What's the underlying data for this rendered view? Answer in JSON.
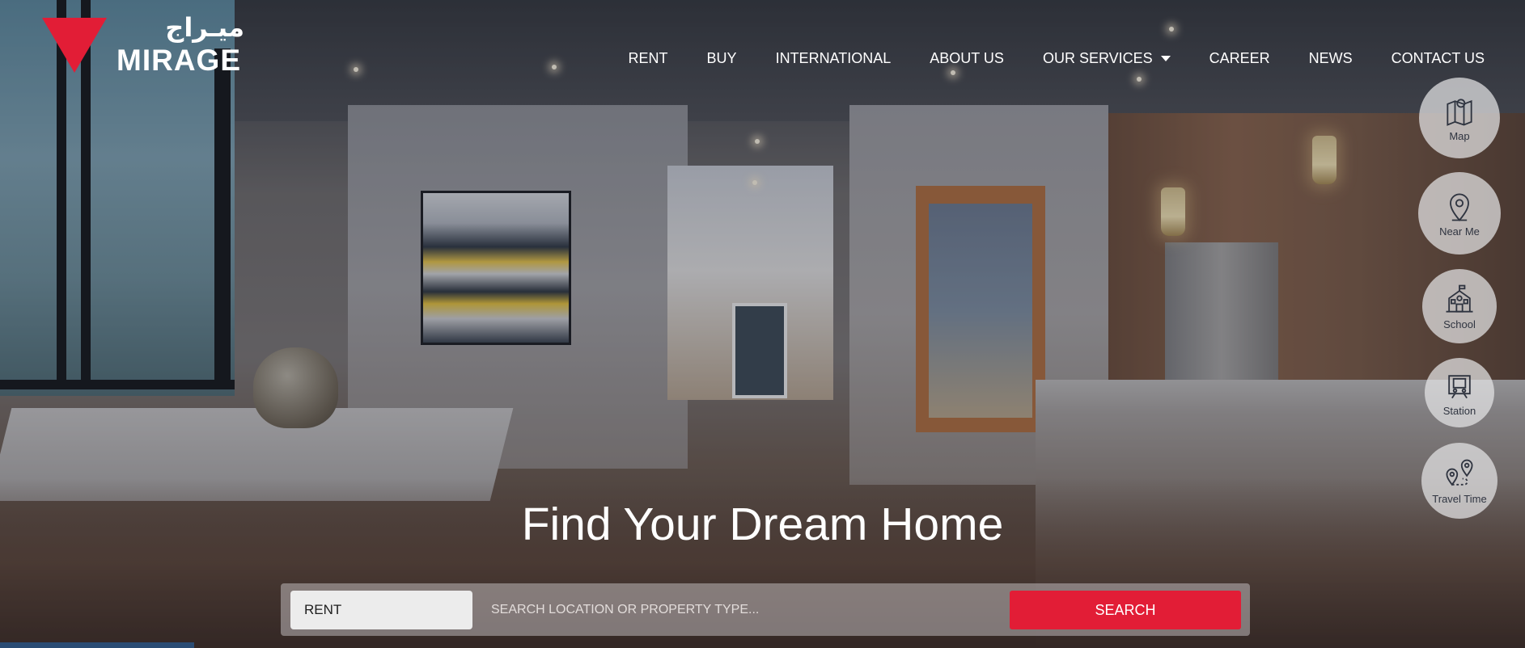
{
  "brand": {
    "name_arabic": "ميـراج",
    "name_english": "MIRAGE",
    "color": "#e21d36"
  },
  "nav": {
    "items": [
      "RENT",
      "BUY",
      "INTERNATIONAL",
      "ABOUT US"
    ],
    "services": "OUR SERVICES",
    "items_after": [
      "CAREER",
      "NEWS",
      "CONTACT US"
    ]
  },
  "side_buttons": [
    {
      "label": "Map",
      "icon": "map-icon"
    },
    {
      "label": "Near Me",
      "icon": "location-pin-icon"
    },
    {
      "label": "School",
      "icon": "school-icon"
    },
    {
      "label": "Station",
      "icon": "station-icon"
    },
    {
      "label": "Travel Time",
      "icon": "travel-time-icon"
    }
  ],
  "hero": {
    "title": "Find Your Dream Home"
  },
  "search": {
    "type_value": "RENT",
    "placeholder": "SEARCH LOCATION OR PROPERTY TYPE...",
    "button_label": "SEARCH"
  }
}
